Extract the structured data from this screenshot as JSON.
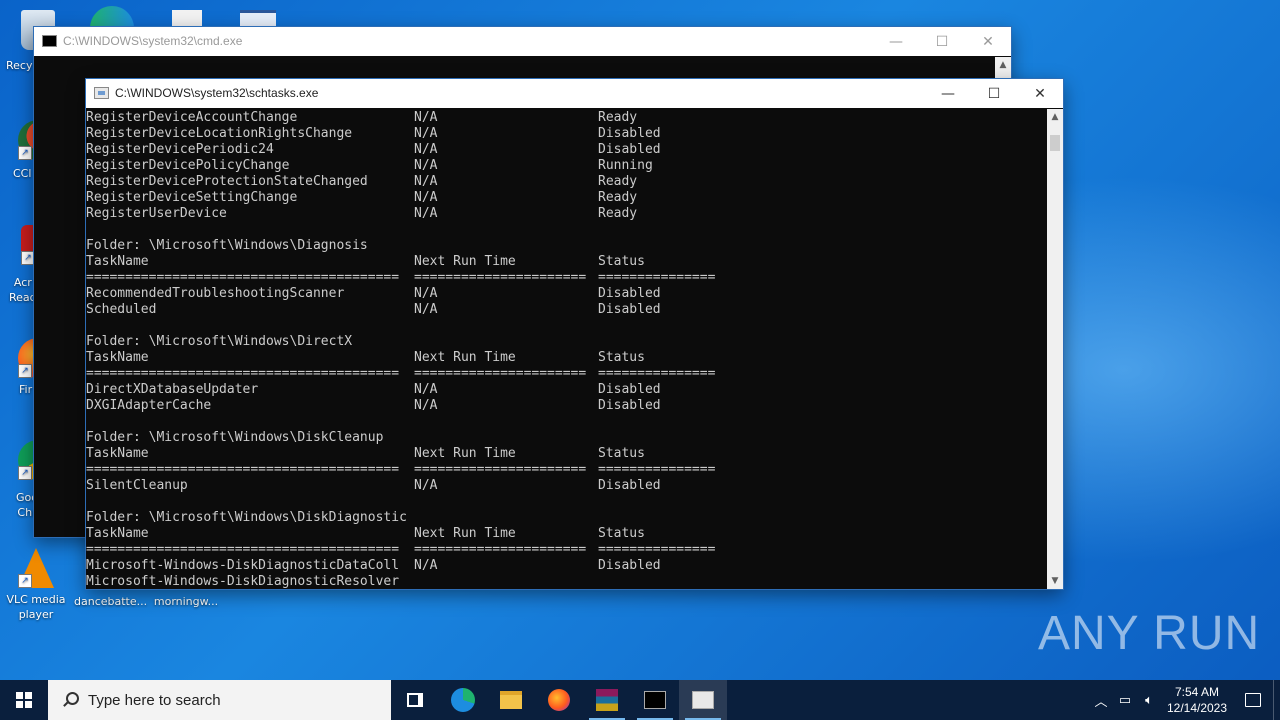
{
  "desktop": {
    "icons": [
      {
        "label": "Recy",
        "icon": "recycle-bin-icon"
      },
      {
        "label": "CCl",
        "icon": "ccleaner-icon"
      },
      {
        "label": "Acr\nRead",
        "icon": "acrobat-reader-icon"
      },
      {
        "label": "Fir",
        "icon": "firefox-icon"
      },
      {
        "label": "Goo\nChr",
        "icon": "chrome-icon"
      },
      {
        "label": "VLC media\nplayer",
        "icon": "vlc-icon"
      },
      {
        "label": "dancebatte...",
        "icon": "file-icon"
      },
      {
        "label": "morningw...",
        "icon": "file-icon"
      }
    ],
    "watermark": "ANY RUN"
  },
  "cmd_window": {
    "title": "C:\\WINDOWS\\system32\\cmd.exe"
  },
  "schtasks_window": {
    "title": "C:\\WINDOWS\\system32\\schtasks.exe",
    "lines": [
      [
        "RegisterDeviceAccountChange",
        "N/A",
        "Ready"
      ],
      [
        "RegisterDeviceLocationRightsChange",
        "N/A",
        "Disabled"
      ],
      [
        "RegisterDevicePeriodic24",
        "N/A",
        "Disabled"
      ],
      [
        "RegisterDevicePolicyChange",
        "N/A",
        "Running"
      ],
      [
        "RegisterDeviceProtectionStateChanged",
        "N/A",
        "Ready"
      ],
      [
        "RegisterDeviceSettingChange",
        "N/A",
        "Ready"
      ],
      [
        "RegisterUserDevice",
        "N/A",
        "Ready"
      ],
      [
        "",
        "",
        ""
      ],
      [
        "Folder: \\Microsoft\\Windows\\Diagnosis",
        "",
        ""
      ],
      [
        "TaskName",
        "Next Run Time",
        "Status"
      ],
      [
        "========================================",
        "======================",
        "==============="
      ],
      [
        "RecommendedTroubleshootingScanner",
        "N/A",
        "Disabled"
      ],
      [
        "Scheduled",
        "N/A",
        "Disabled"
      ],
      [
        "",
        "",
        ""
      ],
      [
        "Folder: \\Microsoft\\Windows\\DirectX",
        "",
        ""
      ],
      [
        "TaskName",
        "Next Run Time",
        "Status"
      ],
      [
        "========================================",
        "======================",
        "==============="
      ],
      [
        "DirectXDatabaseUpdater",
        "N/A",
        "Disabled"
      ],
      [
        "DXGIAdapterCache",
        "N/A",
        "Disabled"
      ],
      [
        "",
        "",
        ""
      ],
      [
        "Folder: \\Microsoft\\Windows\\DiskCleanup",
        "",
        ""
      ],
      [
        "TaskName",
        "Next Run Time",
        "Status"
      ],
      [
        "========================================",
        "======================",
        "==============="
      ],
      [
        "SilentCleanup",
        "N/A",
        "Disabled"
      ],
      [
        "",
        "",
        ""
      ],
      [
        "Folder: \\Microsoft\\Windows\\DiskDiagnostic",
        "",
        ""
      ],
      [
        "TaskName",
        "Next Run Time",
        "Status"
      ],
      [
        "========================================",
        "======================",
        "==============="
      ],
      [
        "Microsoft-Windows-DiskDiagnosticDataColl",
        "N/A",
        "Disabled"
      ],
      [
        "Microsoft-Windows-DiskDiagnosticResolver",
        "",
        ""
      ]
    ]
  },
  "taskbar": {
    "search_placeholder": "Type here to search",
    "apps": [
      "task-view-icon",
      "edge-icon",
      "file-explorer-icon",
      "firefox-icon",
      "winrar-icon",
      "cmd-icon",
      "schtasks-icon"
    ],
    "time": "7:54 AM",
    "date": "12/14/2023"
  }
}
